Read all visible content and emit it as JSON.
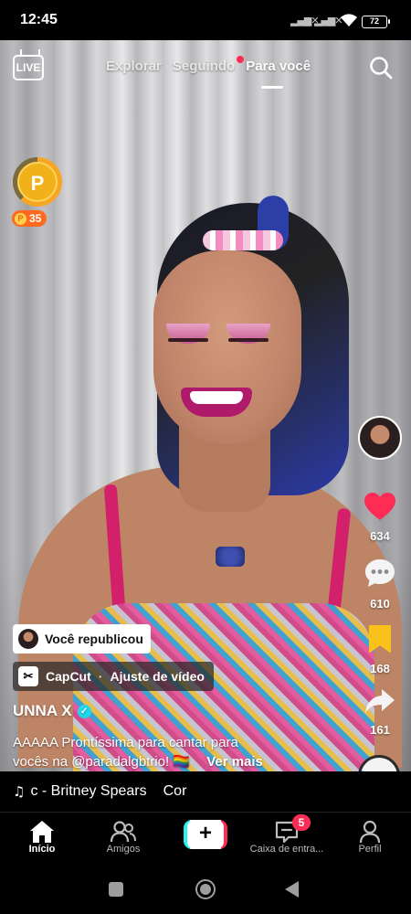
{
  "status_bar": {
    "time": "12:45",
    "battery": "72"
  },
  "top_nav": {
    "live_label": "LIVE",
    "tabs": [
      {
        "label": "Explorar",
        "active": false
      },
      {
        "label": "Seguindo",
        "active": false,
        "has_dot": true
      },
      {
        "label": "Para você",
        "active": true
      }
    ]
  },
  "coins": {
    "symbol": "P",
    "count": "35",
    "progress": 0.62
  },
  "actions": {
    "like_count": "634",
    "comment_count": "610",
    "save_count": "168",
    "share_count": "161"
  },
  "post": {
    "repost_label": "Você republicou",
    "capcut_label": "CapCut",
    "capcut_sep": "·",
    "capcut_action": "Ajuste de vídeo",
    "username": "UNNA X",
    "caption_line1": "AAAAA Prontíssima para cantar para",
    "caption_line2": "vocês na @paradalgbtrio! 🏳️‍🌈",
    "more_label": "Ver mais"
  },
  "music": {
    "track": "c - Britney Spears",
    "track_continued": "Cor"
  },
  "bottom_nav": {
    "home": "Início",
    "friends": "Amigos",
    "create": "+",
    "inbox": "Caixa de entra...",
    "inbox_badge": "5",
    "profile": "Perfil"
  },
  "colors": {
    "accent": "#fe2c55",
    "like": "#fe2c55",
    "save": "#f8c21b",
    "coin": "#f1b11b",
    "coin_badge": "#ff6a1f",
    "verified": "#20d5ec"
  }
}
